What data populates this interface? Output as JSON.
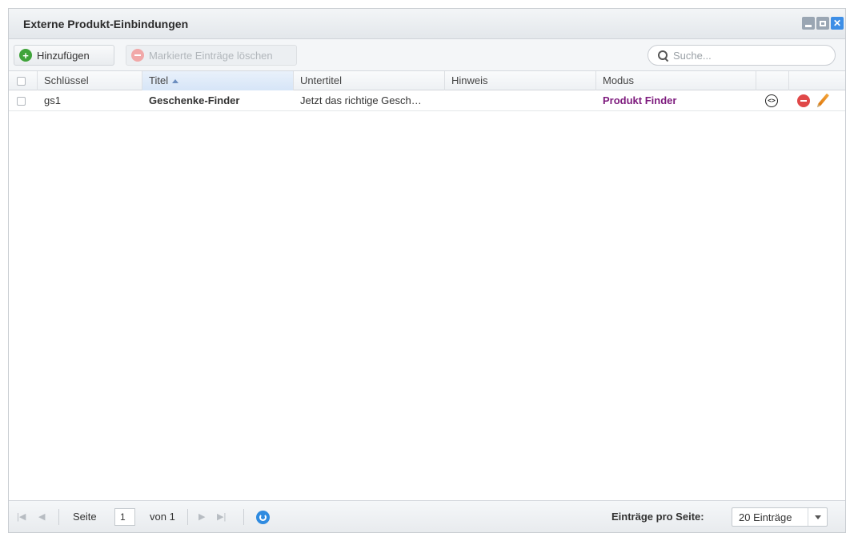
{
  "window": {
    "title": "Externe Produkt-Einbindungen"
  },
  "toolbar": {
    "add_label": "Hinzufügen",
    "delete_label": "Markierte Einträge löschen",
    "search_placeholder": "Suche..."
  },
  "grid": {
    "columns": [
      {
        "label": "Schlüssel"
      },
      {
        "label": "Titel",
        "sorted": "asc"
      },
      {
        "label": "Untertitel"
      },
      {
        "label": "Hinweis"
      },
      {
        "label": "Modus"
      }
    ],
    "rows": [
      {
        "key": "gs1",
        "title": "Geschenke-Finder",
        "subtitle": "Jetzt das richtige Gesch…",
        "hint": "",
        "mode": "Produkt Finder",
        "actions": [
          "code-icon",
          "delete-icon",
          "edit-pencil-icon"
        ]
      }
    ]
  },
  "pager": {
    "page_label": "Seite",
    "current_page": "1",
    "of_label": "von 1",
    "per_page_label": "Einträge pro Seite:",
    "per_page_value": "20 Einträge"
  },
  "colors": {
    "mode_text": "#7d1a7d",
    "add_icon": "#3fa33a",
    "delete_icon": "#e04848",
    "close_button": "#3d8ee6",
    "refresh_icon": "#2f8be0"
  }
}
